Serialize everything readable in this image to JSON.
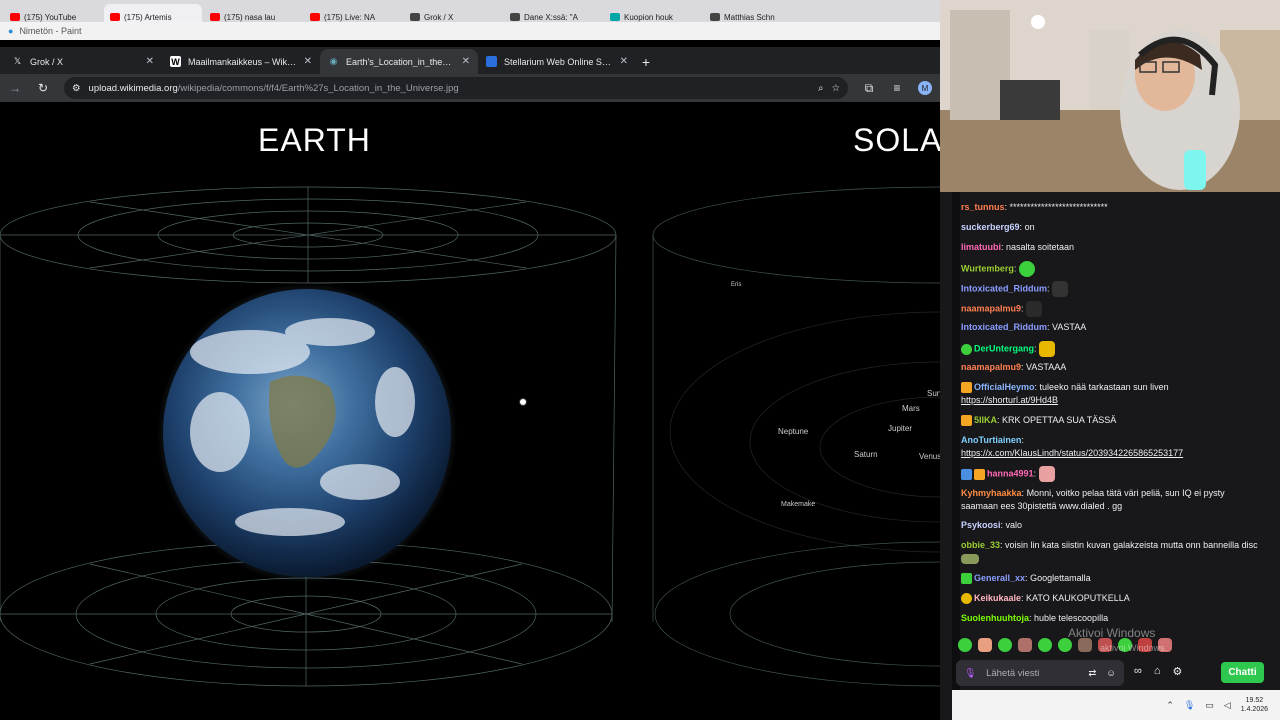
{
  "background_tabs": [
    {
      "label": "(175) YouTube",
      "color": "#ff0000"
    },
    {
      "label": "(175) Artemis",
      "color": "#ff0000"
    },
    {
      "label": "(175) nasa lau",
      "color": "#ff0000"
    },
    {
      "label": "(175) Live: NA",
      "color": "#ff0000"
    },
    {
      "label": "Grok / X",
      "color": "#444444"
    },
    {
      "label": "Dane X:ssä: \"A",
      "color": "#444444"
    },
    {
      "label": "Kuopion houk",
      "color": "#00a6a6"
    },
    {
      "label": "Matthias Schn",
      "color": "#444444"
    }
  ],
  "paint_title": "Nimetön - Paint",
  "browser": {
    "tabs": [
      {
        "label": "Grok / X",
        "icon": "x-logo-icon",
        "active": false
      },
      {
        "label": "Maailmankaikkeus – Wikipedia",
        "icon": "wikipedia-icon",
        "active": false
      },
      {
        "label": "Earth's_Location_in_the_Univers",
        "icon": "earth-icon",
        "active": true
      },
      {
        "label": "Stellarium Web Online Star Ma",
        "icon": "stellarium-icon",
        "active": false
      }
    ],
    "url_host": "upload.wikimedia.org",
    "url_path": "/wikipedia/commons/f/f4/Earth%27s_Location_in_the_Universe.jpg",
    "avatar_letter": "M"
  },
  "image": {
    "left_title": "EARTH",
    "right_title": "SOLAR",
    "planets": {
      "eris": "Eris",
      "neptune": "Neptune",
      "mars": "Mars",
      "jupiter": "Jupiter",
      "saturn": "Saturn",
      "venus": "Venus",
      "sun": "Sun",
      "makemake": "Makemake"
    }
  },
  "chat": {
    "messages": [
      {
        "user": "rs_tunnus",
        "color": "#ff7f50",
        "text": "****************************"
      },
      {
        "user": "suckerberg69",
        "color": "#c7d3ff",
        "text": "on"
      },
      {
        "user": "limatuubi",
        "color": "#ff69b4",
        "text": "nasalta soitetaan"
      },
      {
        "user": "Wurtemberg",
        "color": "#9acd32",
        "text": ""
      },
      {
        "user": "Intoxicated_Riddum",
        "color": "#8a9eff",
        "text": ""
      },
      {
        "user": "naamapalmu9",
        "color": "#ff7f50",
        "text": ""
      },
      {
        "user": "Intoxicated_Riddum",
        "color": "#8a9eff",
        "text": "VASTAA"
      },
      {
        "user": "DerUntergang",
        "color": "#00ff7f",
        "text": ""
      },
      {
        "user": "naamapalmu9",
        "color": "#ff7f50",
        "text": "VASTAAA"
      },
      {
        "user": "OfficialHeymo",
        "color": "#8ab4ff",
        "text": "tuleeko nää tarkastaan sun liven",
        "link": "https://shorturl.at/9Hd4B"
      },
      {
        "user": "5IIKA",
        "color": "#9acd32",
        "text": "KRK OPETTAA SUA TÄSSÄ"
      },
      {
        "user": "AnoTurtiainen",
        "color": "#7fd0ff",
        "text": "",
        "link": "https://x.com/KlausLindh/status/2039342265865253177"
      },
      {
        "user": "hanna4991",
        "color": "#ff69b4",
        "text": ""
      },
      {
        "user": "Kyhmyhaakka",
        "color": "#ff8c42",
        "text": "Monni, voitko pelaa tätä väri peliä, sun IQ ei pysty saamaan ees 30pistettä www.dialed . gg"
      },
      {
        "user": "Psykoosi",
        "color": "#c7d3ff",
        "text": "valo"
      },
      {
        "user": "obbie_33",
        "color": "#9acd32",
        "text": "voisin lin kata siistin kuvan galakzeista mutta onn banneilla disc"
      },
      {
        "user": "Generall_xx",
        "color": "#8a9eff",
        "text": "Googlettamalla"
      },
      {
        "user": "Keikukaale",
        "color": "#ffb6c1",
        "text": "KATO KAUKOPUTKELLA"
      },
      {
        "user": "Suolenhuuhtoja",
        "color": "#7cfc00",
        "text": "huble telescoopilla"
      }
    ],
    "input_placeholder": "Lähetä viesti",
    "send_label": "Chatti",
    "watermark_line1": "Aktivoi Windows",
    "watermark_line2": "aktivoi Windows."
  },
  "taskbar": {
    "time": "19.52",
    "date": "1.4.2026"
  }
}
